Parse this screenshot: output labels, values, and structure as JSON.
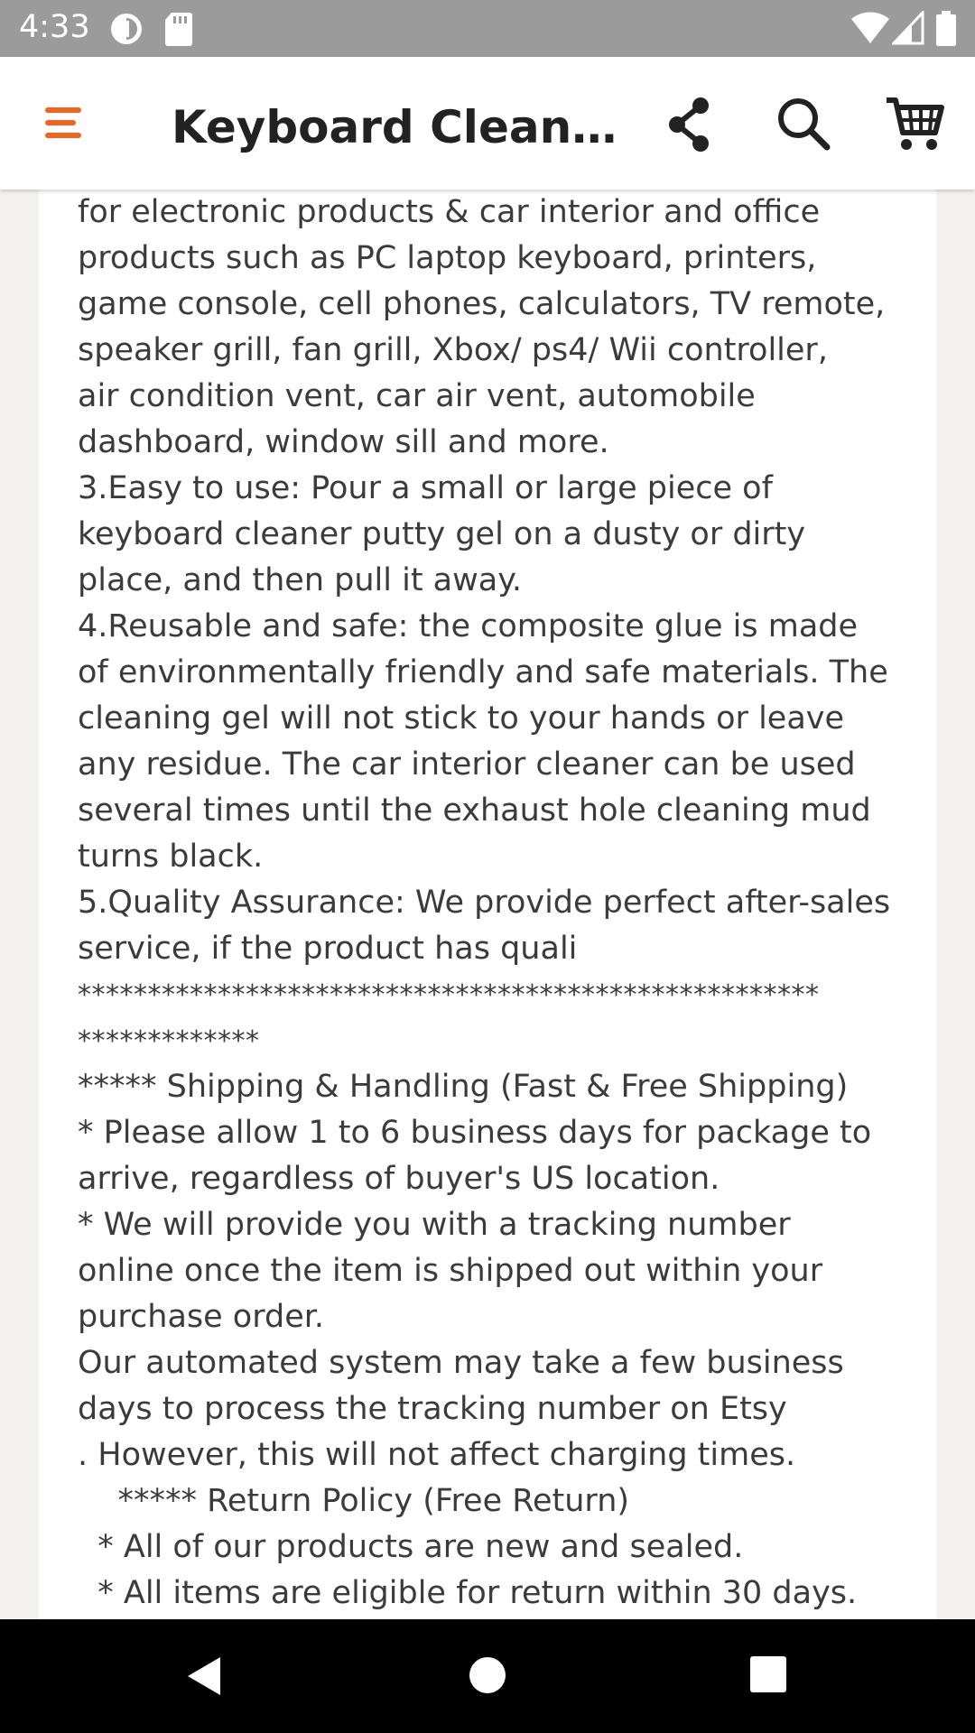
{
  "status_bar": {
    "time": "4:33",
    "icons": [
      "data-saver-icon",
      "sd-card-icon",
      "wifi-icon",
      "signal-icon",
      "battery-icon"
    ]
  },
  "app_bar": {
    "title": "Keyboard Cleane…",
    "menu_icon": "hamburger-menu-icon",
    "share_icon": "share-icon",
    "search_icon": "search-icon",
    "cart_icon": "cart-icon",
    "accent_color": "#f1641e"
  },
  "description": {
    "lines": [
      "for electronic products & car interior and office",
      "products such as PC laptop keyboard, printers,",
      "game console, cell phones, calculators, TV remote,",
      "speaker grill, fan grill, Xbox/ ps4/ Wii controller,",
      "air condition vent, car air vent, automobile",
      "dashboard, window sill and more.",
      "3.Easy to use: Pour a small or large piece of",
      "keyboard cleaner putty gel on a dusty or dirty",
      "place, and then pull it away.",
      "4.Reusable and safe: the composite glue is made",
      "of environmentally friendly and safe materials. The",
      "cleaning gel will not stick to your hands or leave",
      "any residue. The car interior cleaner can be used",
      "several times until the exhaust hole cleaning mud",
      "turns black.",
      "5.Quality Assurance: We provide perfect after-sales",
      "service, if the product has quali",
      "*****************************************************",
      "*************",
      "***** Shipping & Handling (Fast & Free Shipping)",
      "* Please allow 1 to 6 business days for package to",
      "arrive, regardless of buyer's US location.",
      "* We will provide you with a tracking number",
      "online once the item is shipped out within your",
      "purchase order.",
      "Our automated system may take a few business",
      "days to process the tracking number on Etsy",
      ". However, this will not affect charging times.",
      "    ***** Return Policy (Free Return)",
      "  * All of our products are new and sealed.",
      "  * All items are eligible for return within 30 days."
    ]
  },
  "nav_bar": {
    "back_icon": "back-triangle-icon",
    "home_icon": "home-circle-icon",
    "recents_icon": "recents-square-icon"
  }
}
